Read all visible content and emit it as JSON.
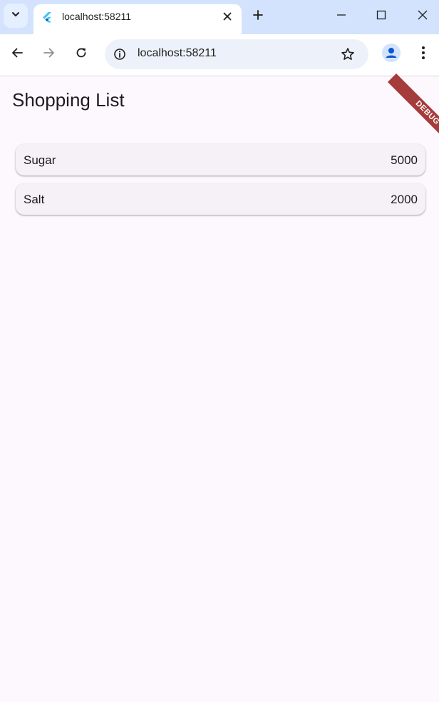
{
  "browser": {
    "tab": {
      "title": "localhost:58211"
    },
    "omnibox": {
      "url": "localhost:58211"
    },
    "icons": {
      "tab_search": "chevron-down-icon",
      "favicon": "flutter-logo-icon",
      "tab_close": "close-icon",
      "new_tab": "plus-icon",
      "minimize": "minimize-icon",
      "maximize": "maximize-icon",
      "window_close": "close-icon",
      "back": "arrow-left-icon",
      "forward": "arrow-right-icon",
      "reload": "reload-icon",
      "site_info": "info-icon",
      "bookmark": "star-icon",
      "profile": "profile-icon",
      "menu": "more-vertical-icon"
    },
    "colors": {
      "tabstrip": "#d3e3fd",
      "omnibox": "#edf2fa",
      "profile": "#0b57d0"
    }
  },
  "app": {
    "title": "Shopping List",
    "debug_banner": "DEBUG",
    "items": [
      {
        "name": "Sugar",
        "quantity": "5000"
      },
      {
        "name": "Salt",
        "quantity": "2000"
      }
    ],
    "colors": {
      "background": "#fdf7fe",
      "card": "#f6f1f7",
      "banner": "#a63b3b"
    }
  }
}
